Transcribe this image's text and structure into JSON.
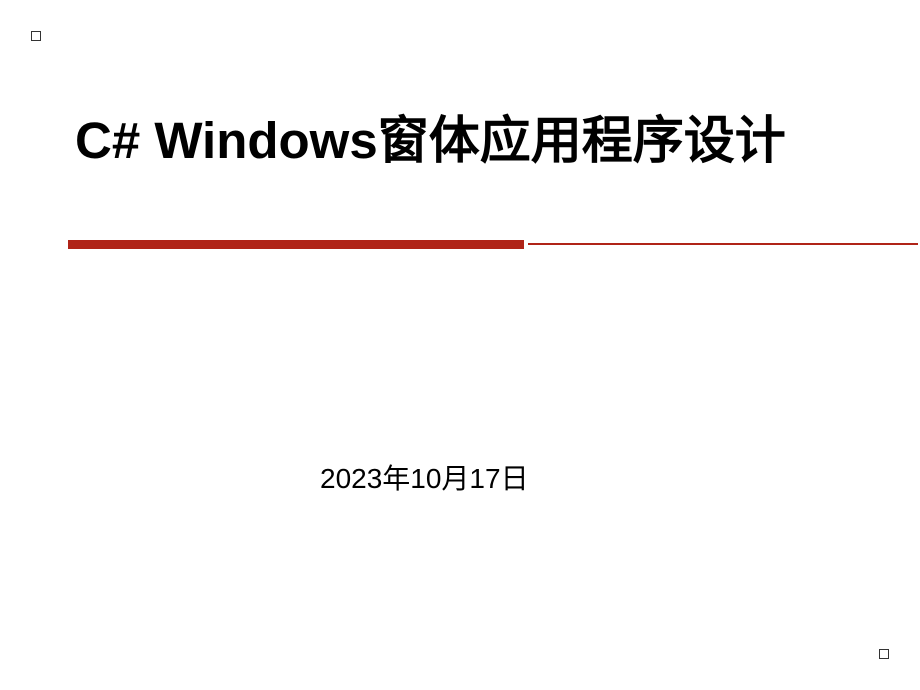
{
  "slide": {
    "title": "C# Windows窗体应用程序设计",
    "date": "2023年10月17日"
  },
  "colors": {
    "accent": "#b02418",
    "text": "#000000",
    "background": "#ffffff"
  }
}
